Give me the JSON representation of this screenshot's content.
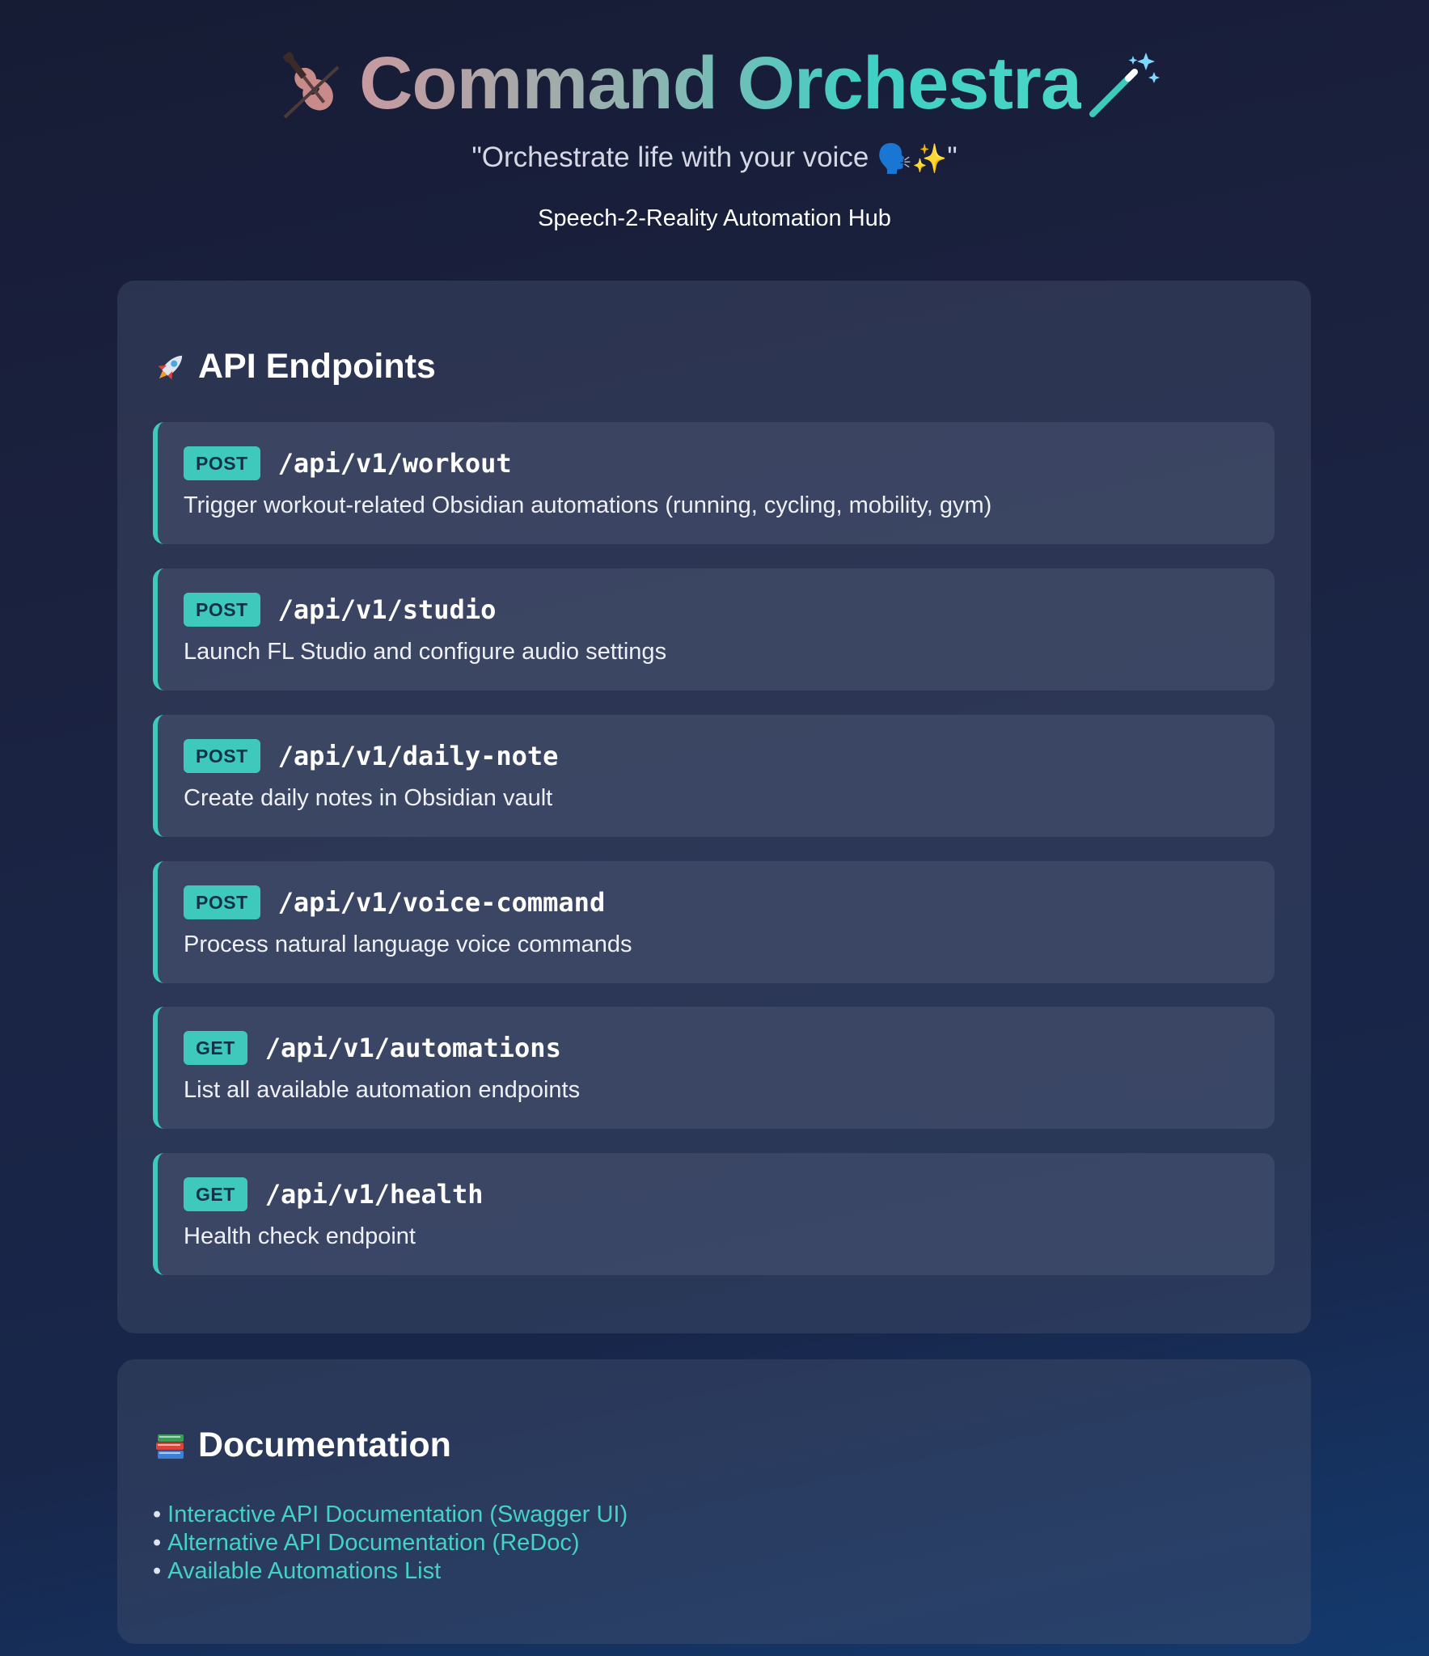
{
  "header": {
    "title": "Command Orchestra",
    "tagline_before": "\"Orchestrate life with your voice ",
    "tagline_emoji": "🗣️✨",
    "tagline_after": "\"",
    "subtitle": "Speech-2-Reality Automation Hub",
    "title_icon": "violin-icon",
    "wand_icon": "magic-wand-icon"
  },
  "api": {
    "heading": "API Endpoints",
    "heading_icon": "rocket-icon",
    "endpoints": [
      {
        "method": "POST",
        "path": "/api/v1/workout",
        "description": "Trigger workout-related Obsidian automations (running, cycling, mobility, gym)"
      },
      {
        "method": "POST",
        "path": "/api/v1/studio",
        "description": "Launch FL Studio and configure audio settings"
      },
      {
        "method": "POST",
        "path": "/api/v1/daily-note",
        "description": "Create daily notes in Obsidian vault"
      },
      {
        "method": "POST",
        "path": "/api/v1/voice-command",
        "description": "Process natural language voice commands"
      },
      {
        "method": "GET",
        "path": "/api/v1/automations",
        "description": "List all available automation endpoints"
      },
      {
        "method": "GET",
        "path": "/api/v1/health",
        "description": "Health check endpoint"
      }
    ]
  },
  "docs": {
    "heading": "Documentation",
    "heading_icon": "books-icon",
    "bullet": "•",
    "links": [
      {
        "label": "Interactive API Documentation (Swagger UI)"
      },
      {
        "label": "Alternative API Documentation (ReDoc)"
      },
      {
        "label": "Available Automations List"
      }
    ]
  },
  "colors": {
    "accent": "#3fc9bd",
    "link": "#45d1c3",
    "background": "#1b2342"
  }
}
